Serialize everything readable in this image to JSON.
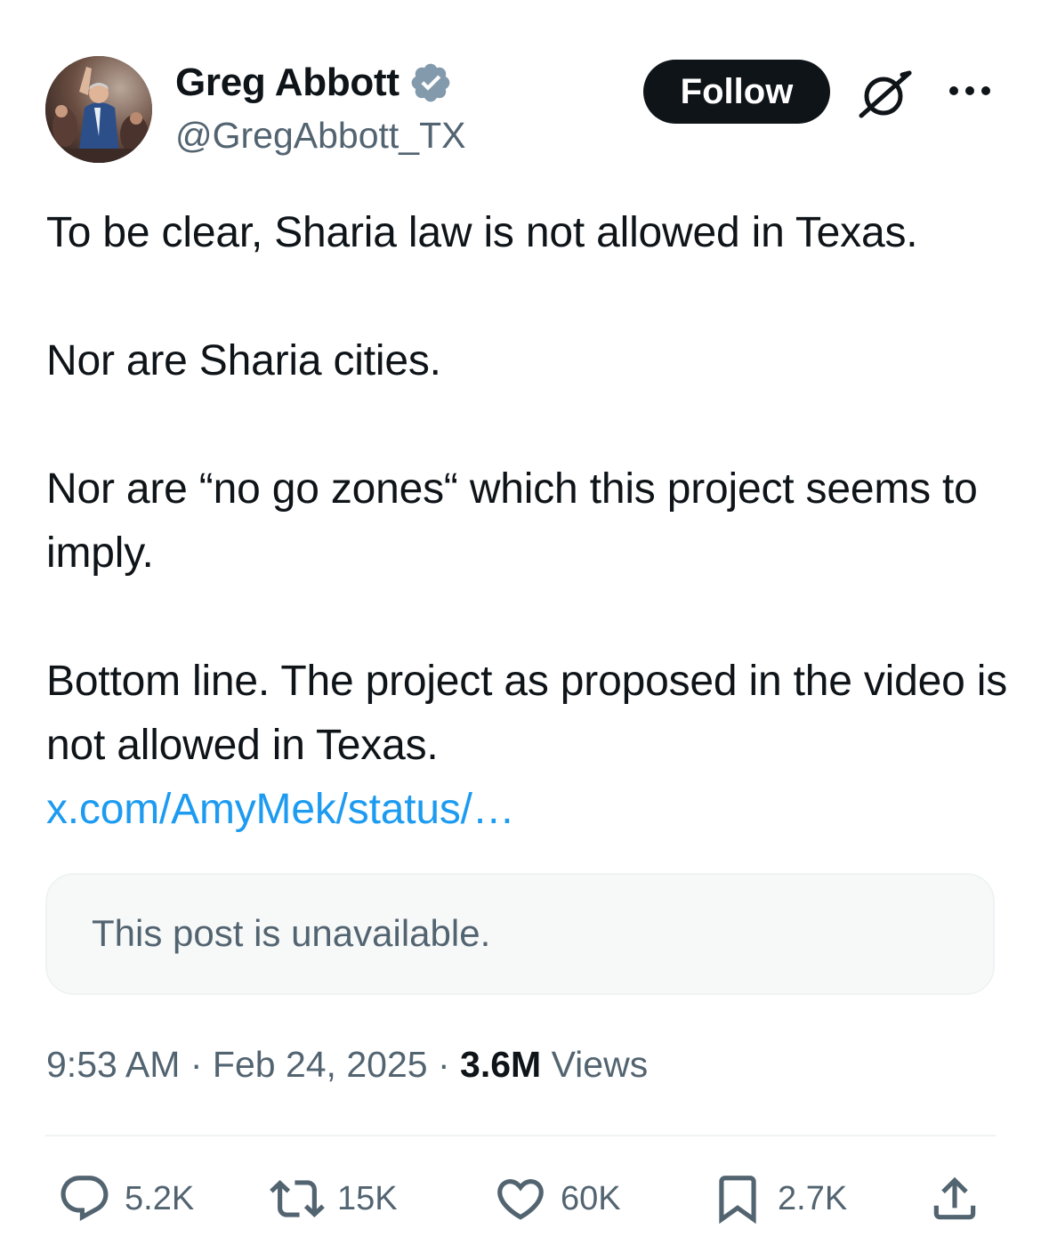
{
  "author": {
    "display_name": "Greg Abbott",
    "handle": "@GregAbbott_TX",
    "verified": true,
    "avatar_icon": "profile-photo"
  },
  "header": {
    "follow_label": "Follow",
    "grok_icon": "grok-icon",
    "more_icon": "more-icon"
  },
  "post": {
    "paragraphs": [
      "To be clear, Sharia law is not allowed in Texas.",
      "Nor are Sharia cities.",
      "Nor are “no go zones“ which this project seems to imply.",
      "Bottom line. The project as proposed in the video is not allowed in Texas."
    ],
    "link_text": "x.com/AmyMek/status/…"
  },
  "quoted": {
    "unavailable_text": "This post is unavailable."
  },
  "meta": {
    "time": "9:53 AM",
    "separator": "·",
    "date": "Feb 24, 2025",
    "views_count": "3.6M",
    "views_label": "Views"
  },
  "actions": {
    "replies": "5.2K",
    "reposts": "15K",
    "likes": "60K",
    "bookmarks": "2.7K"
  },
  "colors": {
    "text": "#0f1419",
    "secondary": "#536471",
    "link": "#1d9bf0",
    "verified_badge": "#829aab",
    "card_bg": "#f7f9f9"
  }
}
